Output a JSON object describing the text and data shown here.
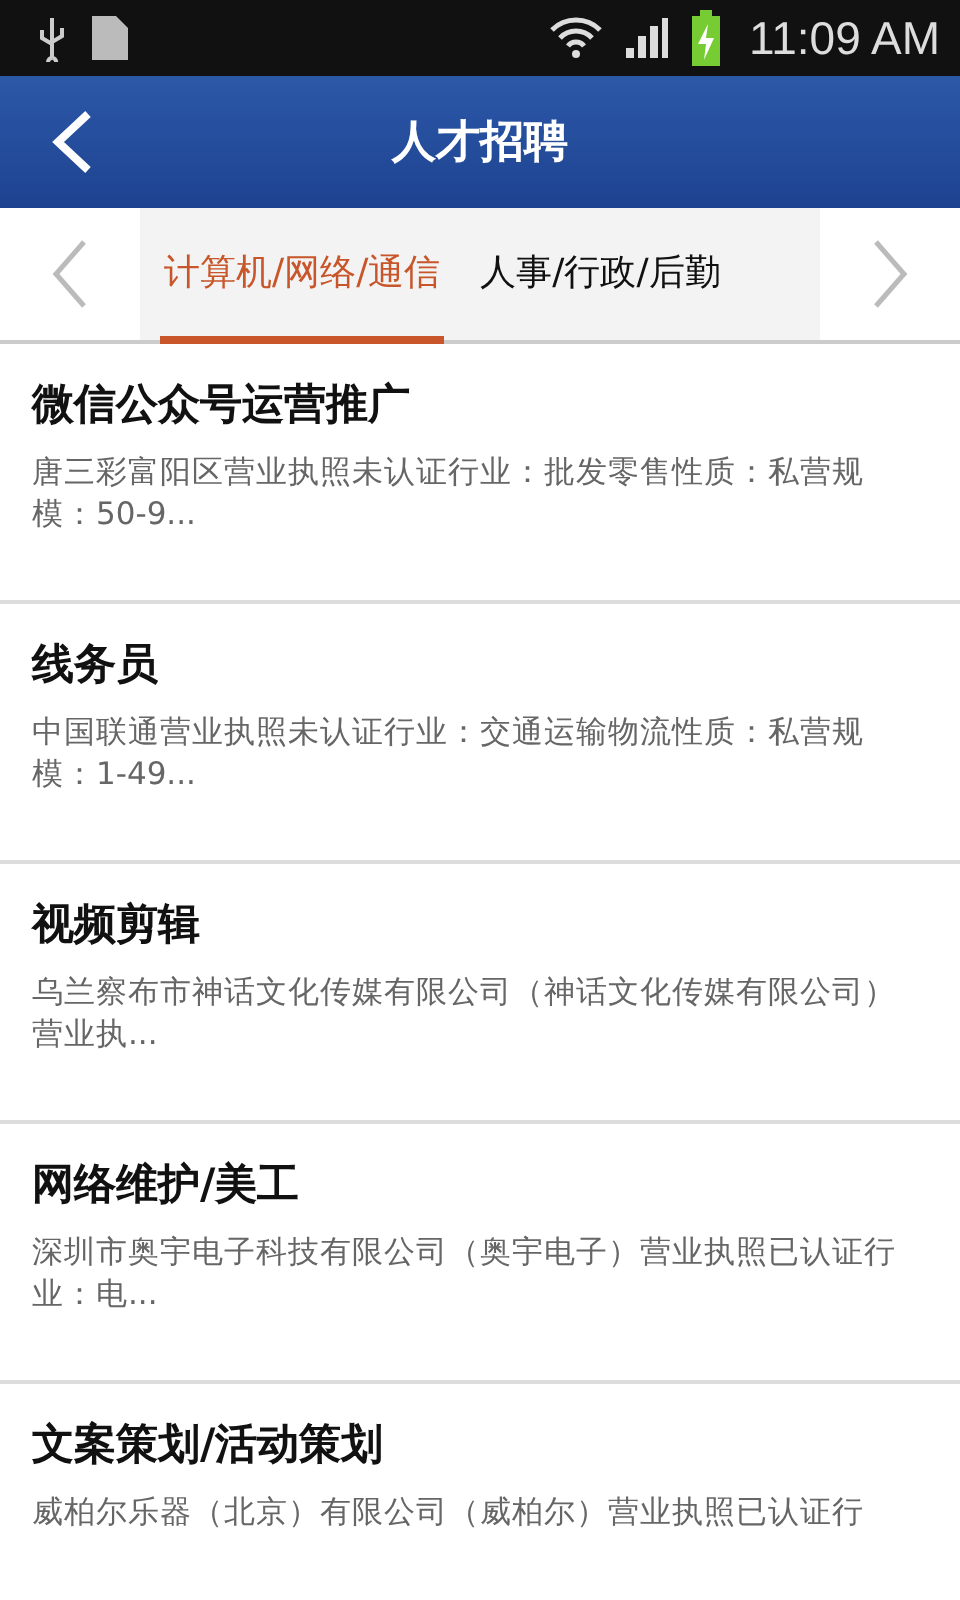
{
  "status_bar": {
    "time": "11:09 AM"
  },
  "header": {
    "title": "人才招聘"
  },
  "tabs": [
    {
      "label": "计算机/网络/通信",
      "selected": true
    },
    {
      "label": "人事/行政/后勤",
      "selected": false
    }
  ],
  "jobs": [
    {
      "title": "微信公众号运营推广",
      "description": "唐三彩富阳区营业执照未认证行业：批发零售性质：私营规模：50-9..."
    },
    {
      "title": "线务员",
      "description": "中国联通营业执照未认证行业：交通运输物流性质：私营规模：1-49..."
    },
    {
      "title": "视频剪辑",
      "description": "乌兰察布市神话文化传媒有限公司（神话文化传媒有限公司）营业执..."
    },
    {
      "title": "网络维护/美工",
      "description": "深圳市奥宇电子科技有限公司（奥宇电子）营业执照已认证行业：电..."
    },
    {
      "title": "文案策划/活动策划",
      "description": "威柏尔乐器（北京）有限公司（威柏尔）营业执照已认证行"
    }
  ]
}
